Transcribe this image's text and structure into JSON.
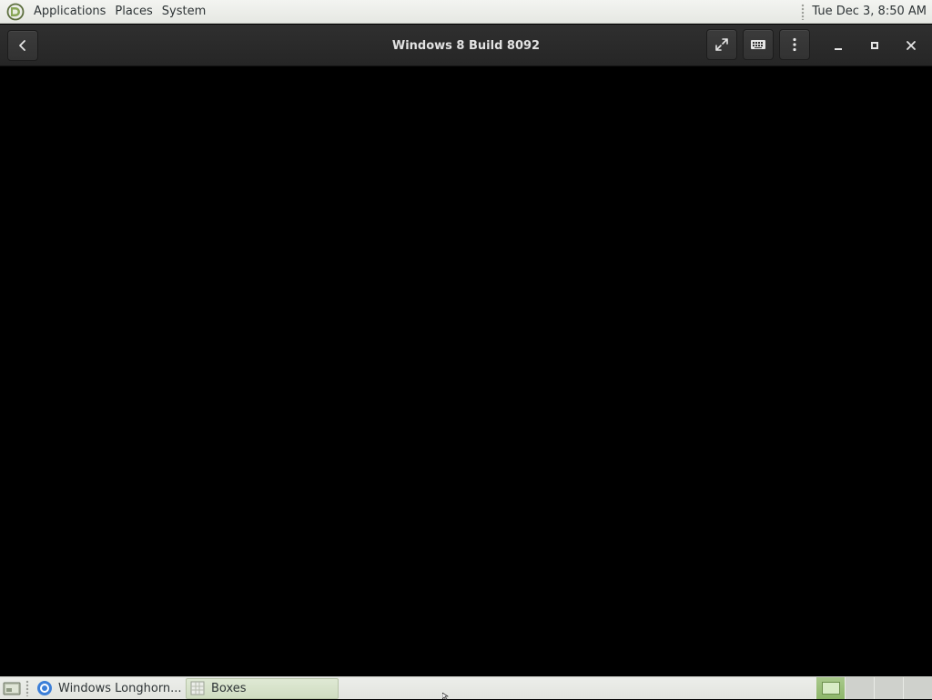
{
  "top_panel": {
    "menus": {
      "applications": "Applications",
      "places": "Places",
      "system": "System"
    },
    "clock": "Tue Dec  3,  8:50 AM"
  },
  "window": {
    "title": "Windows 8 Build 8092",
    "buttons": {
      "back": "back-icon",
      "fullscreen": "fullscreen-icon",
      "keyboard": "keyboard-icon",
      "menu": "menu-icon",
      "minimize": "minimize-icon",
      "maximize": "maximize-icon",
      "close": "close-icon"
    }
  },
  "taskbar": {
    "tasks": [
      {
        "label": "Windows Longhorn...",
        "icon": "browser-icon",
        "active": false
      },
      {
        "label": "Boxes",
        "icon": "boxes-app-icon",
        "active": true
      }
    ],
    "workspaces": 4,
    "active_workspace": 1
  },
  "colors": {
    "panel_bg": "#e6e8e3",
    "headerbar_bg": "#2b2b2b",
    "display_bg": "#000000",
    "active_accent": "#8db66a"
  }
}
